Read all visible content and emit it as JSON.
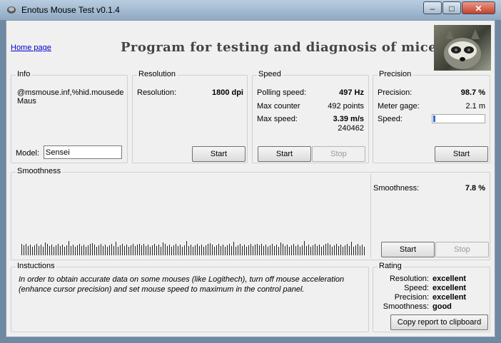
{
  "window": {
    "title": "Enotus Mouse Test v0.1.4",
    "minimize": "–",
    "maximize": "□",
    "close": "✕"
  },
  "header": {
    "home_link": "Home page",
    "heading": "Program for testing and diagnosis of mice"
  },
  "info": {
    "title": "Info",
    "device_id": "@msmouse.inf,%hid.mousede",
    "device_name": "Maus",
    "model_label": "Model:",
    "model_value": "Sensei"
  },
  "resolution": {
    "title": "Resolution",
    "label": "Resolution:",
    "value": "1800 dpi",
    "start": "Start"
  },
  "speed": {
    "title": "Speed",
    "polling_label": "Polling speed:",
    "polling_value": "497 Hz",
    "counter_label": "Max counter",
    "counter_value": "492 points",
    "maxspeed_label": "Max  speed:",
    "maxspeed_value": "3.39 m/s",
    "raw_value": "240462",
    "start": "Start",
    "stop": "Stop"
  },
  "precision": {
    "title": "Precision",
    "precision_label": "Precision:",
    "precision_value": "98.7 %",
    "meter_label": "Meter gage:",
    "meter_value": "2.1 m",
    "speed_label": "Speed:",
    "speed_level": 0.04,
    "start": "Start"
  },
  "smoothness": {
    "title": "Smoothness",
    "label": "Smoothness:",
    "value": "7.8 %",
    "start": "Start",
    "stop": "Stop"
  },
  "instructions": {
    "title": "Instuctions",
    "text": "In order to obtain accurate data on some mouses (like Logithech), turn off mouse acceleration (enhance cursor precision) and set mouse speed to maximum in the control panel."
  },
  "rating": {
    "title": "Rating",
    "resolution_label": "Resolution:",
    "resolution_value": "excellent",
    "speed_label": "Speed:",
    "speed_value": "excellent",
    "precision_label": "Precision:",
    "precision_value": "excellent",
    "smoothness_label": "Smoothness:",
    "smoothness_value": "good",
    "copy_button": "Copy report to clipboard"
  }
}
